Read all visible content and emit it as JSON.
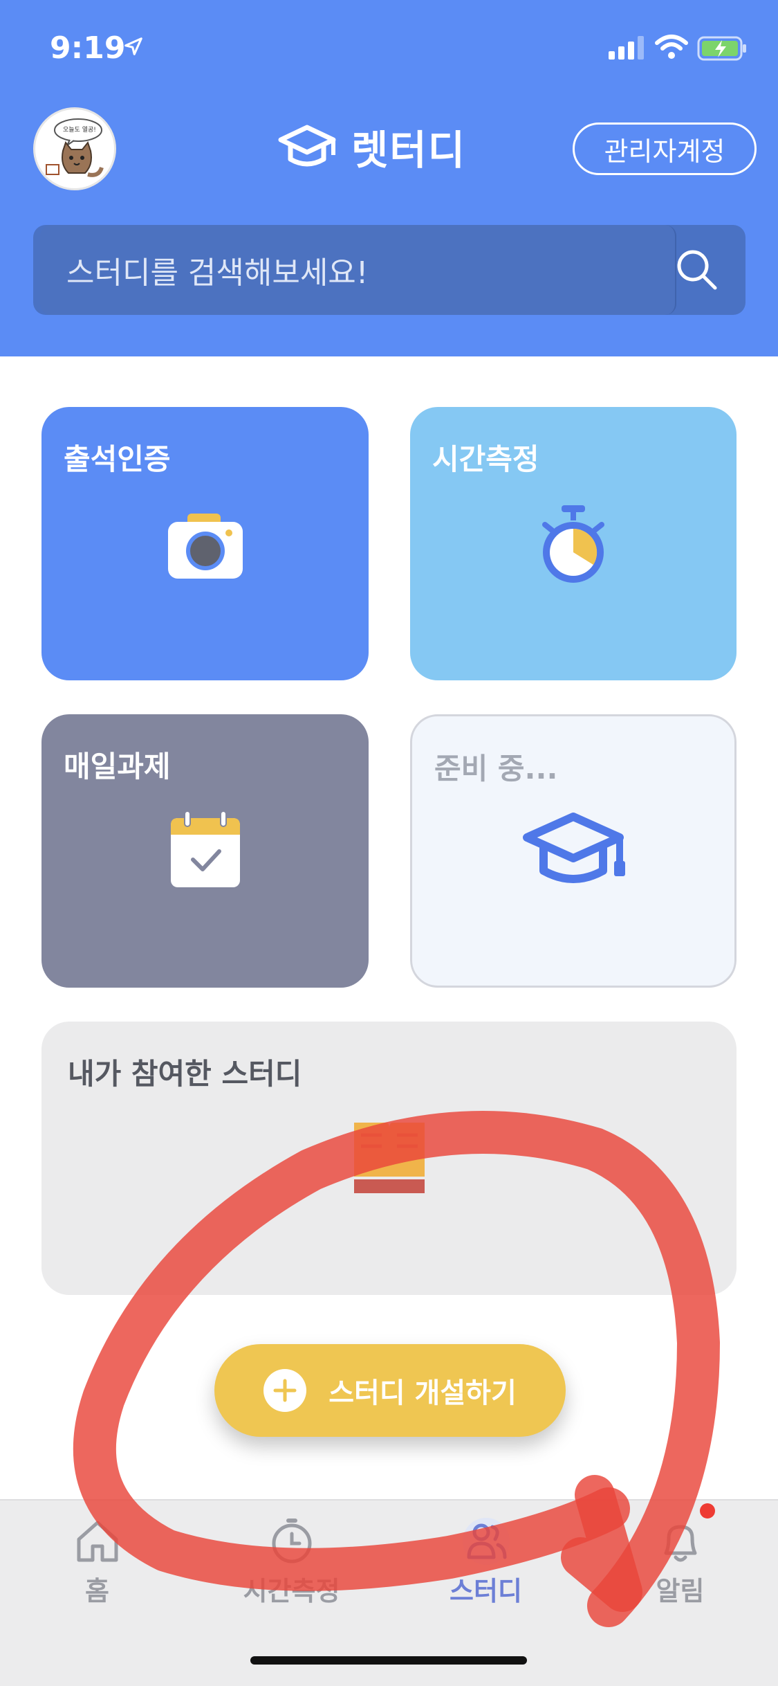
{
  "status_bar": {
    "time": "9:19"
  },
  "header": {
    "app_title": "렛터디",
    "admin_button": "관리자계정",
    "avatar_text": "오늘도 열공!",
    "search": {
      "placeholder": "스터디를 검색해보세요!"
    }
  },
  "cards": [
    {
      "title": "출석인증",
      "icon": "camera-icon",
      "color": "#5b8cf5"
    },
    {
      "title": "시간측정",
      "icon": "stopwatch-icon",
      "color": "#85c8f3"
    },
    {
      "title": "매일과제",
      "icon": "calendar-check-icon",
      "color": "#82869e"
    },
    {
      "title": "준비 중...",
      "icon": "graduation-cap-icon",
      "color": "#f2f6fc"
    },
    {
      "title": "내가 참여한 스터디",
      "icon": "book-icon",
      "color": "#ebebec"
    }
  ],
  "create_button": {
    "label": "스터디 개설하기"
  },
  "tabbar": {
    "items": [
      {
        "label": "홈",
        "icon": "home-icon"
      },
      {
        "label": "시간측정",
        "icon": "clock-icon"
      },
      {
        "label": "스터디",
        "icon": "users-icon",
        "active": true
      },
      {
        "label": "알림",
        "icon": "bell-icon",
        "badge": true
      }
    ]
  },
  "colors": {
    "primary": "#5b8cf5",
    "accent_yellow": "#efc652",
    "annotation_red": "#e9463b"
  }
}
